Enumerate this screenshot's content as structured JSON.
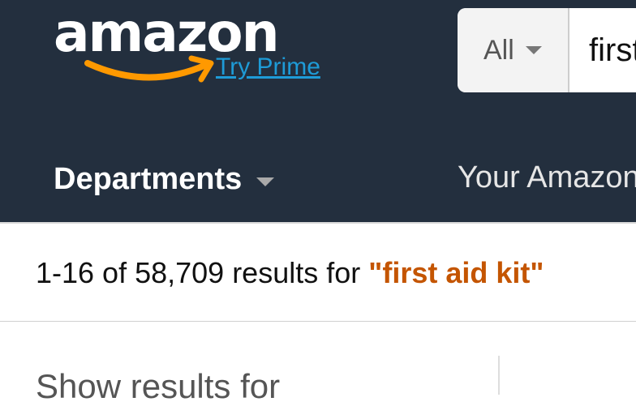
{
  "header": {
    "logo_text": "amazon",
    "try_prime_label": "Try Prime",
    "search": {
      "scope_label": "All",
      "query_value": "first aid kit"
    },
    "nav": {
      "departments_label": "Departments",
      "your_amazon_label": "Your Amazon"
    }
  },
  "results": {
    "summary": "1-16 of 58,709 results for",
    "query": "\"first aid kit\""
  },
  "sidebar": {
    "title": "Show results for"
  },
  "colors": {
    "nav_background": "#232f3e",
    "prime_link": "#1e9bd7",
    "query_highlight": "#c45500",
    "logo_smile": "#f90"
  }
}
